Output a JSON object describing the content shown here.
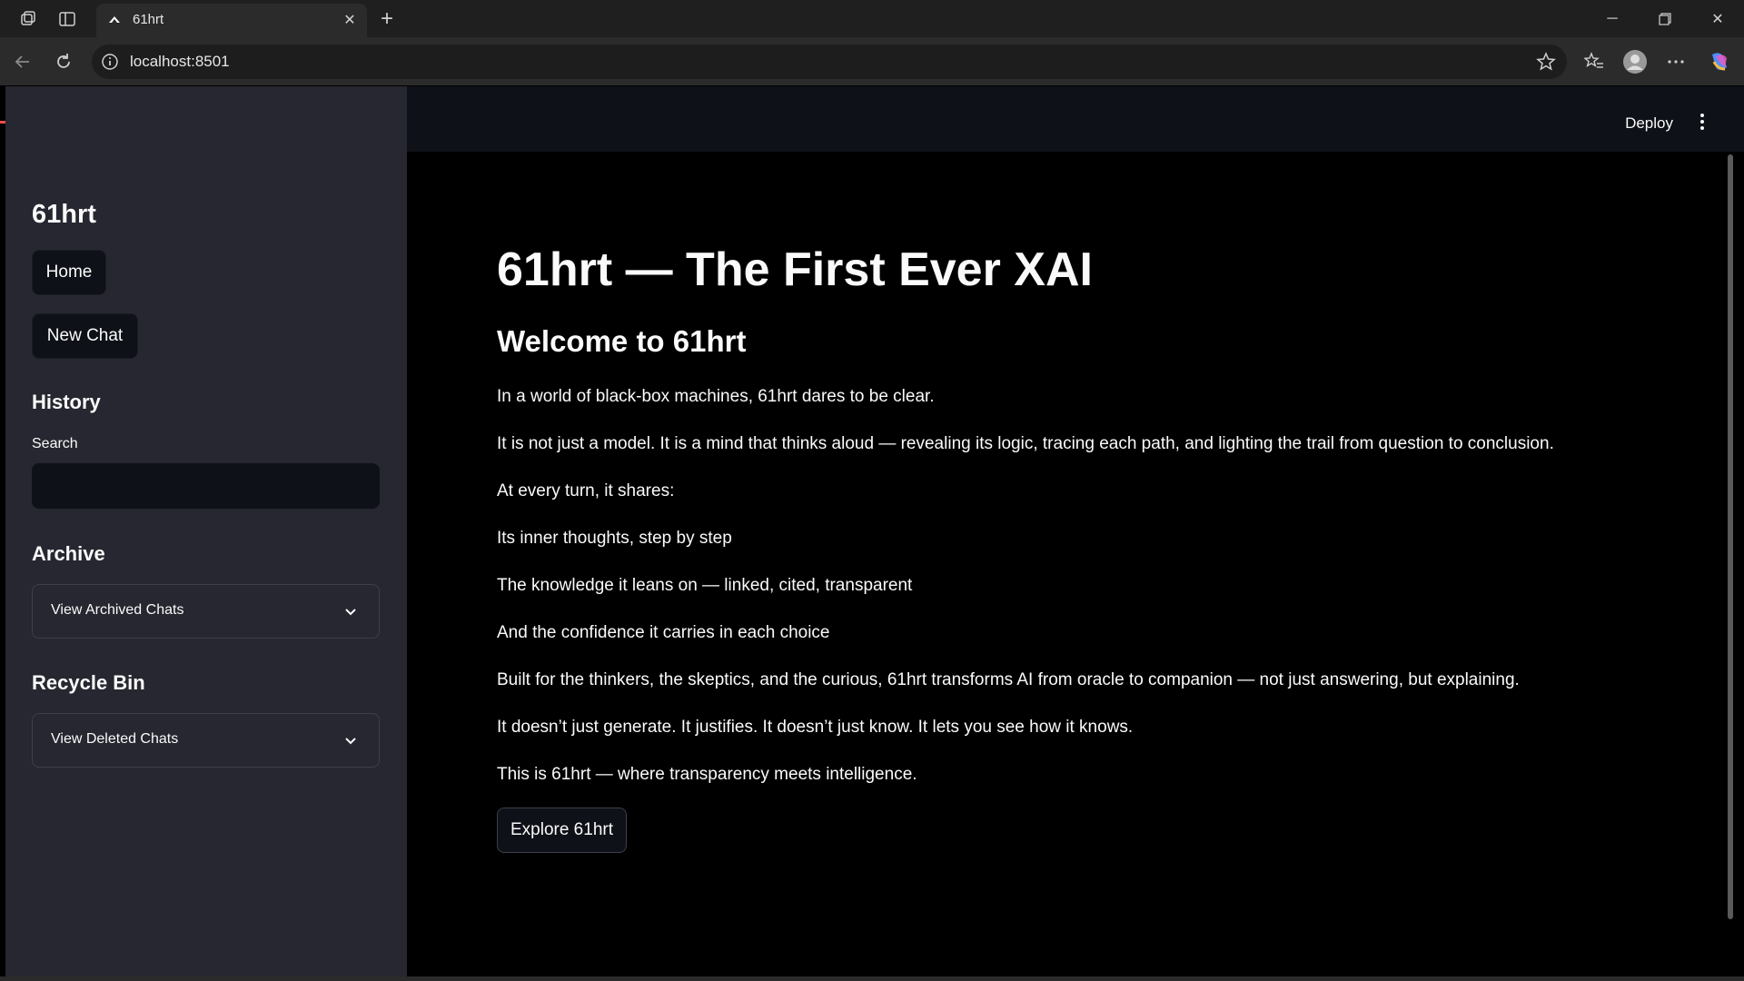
{
  "browser": {
    "tab_title": "61hrt",
    "url": "localhost:8501"
  },
  "header": {
    "deploy_label": "Deploy"
  },
  "sidebar": {
    "title": "61hrt",
    "home_label": "Home",
    "new_chat_label": "New Chat",
    "history_heading": "History",
    "search_label": "Search",
    "search_value": "",
    "archive_heading": "Archive",
    "archive_expander": "View Archived Chats",
    "recycle_heading": "Recycle Bin",
    "recycle_expander": "View Deleted Chats"
  },
  "main": {
    "title": "61hrt — The First Ever XAI",
    "subtitle": "Welcome to 61hrt",
    "paragraphs": [
      "In a world of black-box machines, 61hrt dares to be clear.",
      "It is not just a model. It is a mind that thinks aloud — revealing its logic, tracing each path, and lighting the trail from question to conclusion.",
      "At every turn, it shares:",
      "Its inner thoughts, step by step",
      "The knowledge it leans on — linked, cited, transparent",
      "And the confidence it carries in each choice",
      "Built for the thinkers, the skeptics, and the curious, 61hrt transforms AI from oracle to companion — not just answering, but explaining.",
      "It doesn’t just generate. It justifies. It doesn’t just know. It lets you see how it knows.",
      "This is 61hrt — where transparency meets intelligence."
    ],
    "explore_label": "Explore 61hrt"
  },
  "colors": {
    "sidebar_bg": "#262730",
    "header_bg": "#0e1117",
    "main_bg": "#000000",
    "accent_red": "#ff4b4b"
  }
}
